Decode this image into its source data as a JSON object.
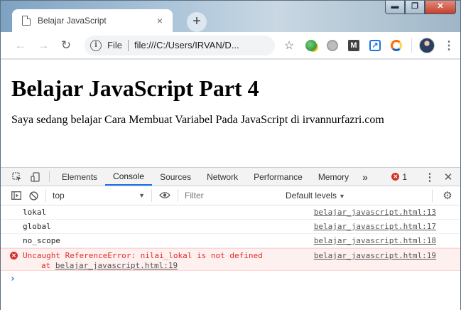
{
  "window": {
    "minimize": "▬",
    "maximize": "❐",
    "close": "✕"
  },
  "tab": {
    "title": "Belajar JavaScript",
    "close": "×"
  },
  "newtab": "+",
  "toolbar": {
    "back": "←",
    "forward": "→",
    "reload": "↻",
    "info": "i",
    "scheme": "File",
    "url": "file:///C:/Users/IRVAN/D...",
    "star": "☆",
    "menu": "⋮",
    "ext3": "M",
    "ext4": "↗"
  },
  "page": {
    "heading": "Belajar JavaScript Part 4",
    "paragraph": "Saya sedang belajar Cara Membuat Variabel Pada JavaScript di irvannurfazri.com"
  },
  "devtools": {
    "tabs": [
      "Elements",
      "Console",
      "Sources",
      "Network",
      "Performance",
      "Memory"
    ],
    "more": "»",
    "error_count": "1",
    "error_glyph": "✕",
    "kebab": "⋮",
    "close": "✕",
    "context": "top",
    "filter_placeholder": "Filter",
    "levels": "Default levels",
    "dropdown": "▼",
    "gear": "⚙"
  },
  "console": {
    "logs": [
      {
        "message": "lokal",
        "source": "belajar_javascript.html:13"
      },
      {
        "message": "global",
        "source": "belajar_javascript.html:17"
      },
      {
        "message": "no_scope",
        "source": "belajar_javascript.html:18"
      }
    ],
    "error": {
      "message": "Uncaught ReferenceError: nilai_lokal is not defined",
      "at": "at",
      "at_link": "belajar_javascript.html:19",
      "source": "belajar_javascript.html:19"
    },
    "prompt": "›"
  }
}
